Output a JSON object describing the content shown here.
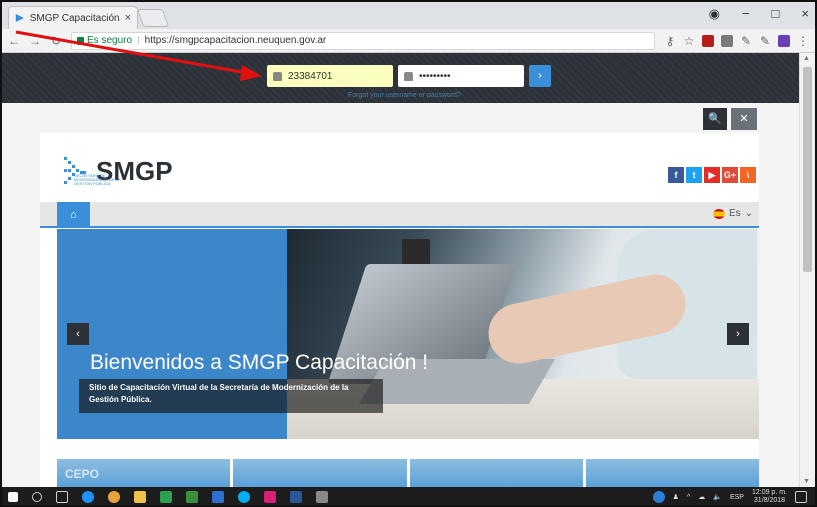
{
  "browser": {
    "tab_title": "SMGP Capacitación",
    "tab_close": "×",
    "window_controls": [
      "−",
      "□",
      "×"
    ],
    "secure_label": "Es seguro",
    "url": "https://smgpcapacitacion.neuquen.gov.ar"
  },
  "login": {
    "username_value": "23384701",
    "password_value": "•••••••••",
    "submit_icon": "›",
    "forgot_link": "Forgot your username or password?"
  },
  "search": {
    "search_icon": "🔍",
    "close_icon": "✕"
  },
  "site": {
    "logo_text": "SMGP",
    "logo_subtitle": "SECRETARIA DE MODERNIZACION DE LA GESTION PUBLICA",
    "social": [
      {
        "label": "f",
        "color": "#3b5998"
      },
      {
        "label": "t",
        "color": "#1da1f2"
      },
      {
        "label": "▶",
        "color": "#e52d27"
      },
      {
        "label": "G+",
        "color": "#dd4b39"
      },
      {
        "label": "\\",
        "color": "#f26522"
      }
    ],
    "home_icon": "⌂",
    "language": "Es",
    "language_caret": "⌄"
  },
  "slider": {
    "title": "Bienvenidos a SMGP Capacitación !",
    "caption": "Sitio de Capacitación Virtual de la Secretaría de Modernización de la Gestión Pública.",
    "prev": "‹",
    "next": "›",
    "accent": "#3b87c9"
  },
  "tiles": [
    "CEPO",
    "",
    "",
    ""
  ],
  "taskbar": {
    "lang": "ESP",
    "time": "12:09 p. m.",
    "date": "31/8/2018"
  },
  "colors": {
    "topbar": "#2c3138",
    "accent": "#3a8fd8",
    "autofill": "#faffbd",
    "annotation": "#e01010"
  }
}
